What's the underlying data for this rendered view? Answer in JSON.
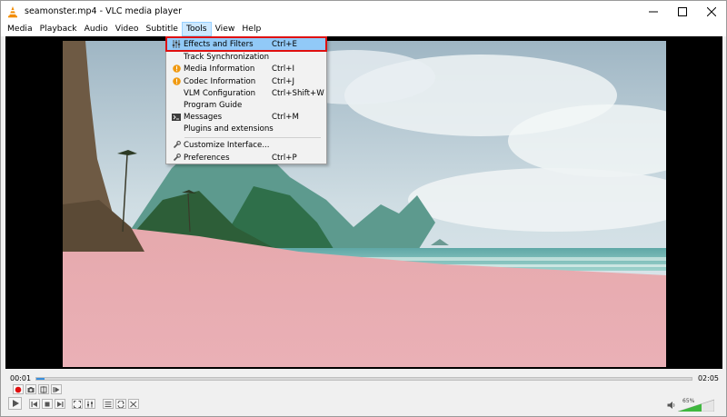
{
  "window": {
    "title": "seamonster.mp4 - VLC media player",
    "icon": "vlc-cone-icon"
  },
  "menubar": {
    "items": [
      "Media",
      "Playback",
      "Audio",
      "Video",
      "Subtitle",
      "Tools",
      "View",
      "Help"
    ],
    "active": "Tools"
  },
  "tools_menu": {
    "items": [
      {
        "label": "Effects and Filters",
        "shortcut": "Ctrl+E",
        "icon": "equalizer-icon",
        "highlighted": true
      },
      {
        "label": "Track Synchronization",
        "shortcut": "",
        "icon": ""
      },
      {
        "label": "Media Information",
        "shortcut": "Ctrl+I",
        "icon": "info-icon"
      },
      {
        "label": "Codec Information",
        "shortcut": "Ctrl+J",
        "icon": "info-icon"
      },
      {
        "label": "VLM Configuration",
        "shortcut": "Ctrl+Shift+W",
        "icon": ""
      },
      {
        "label": "Program Guide",
        "shortcut": "",
        "icon": ""
      },
      {
        "label": "Messages",
        "shortcut": "Ctrl+M",
        "icon": "terminal-icon"
      },
      {
        "label": "Plugins and extensions",
        "shortcut": "",
        "icon": ""
      },
      {
        "label": "Customize Interface...",
        "shortcut": "",
        "icon": "wrench-icon"
      },
      {
        "label": "Preferences",
        "shortcut": "Ctrl+P",
        "icon": "wrench-icon"
      }
    ]
  },
  "player": {
    "elapsed": "00:01",
    "duration": "02:05",
    "progress": 0.012,
    "volume_label": "65%",
    "volume": 0.65
  },
  "colors": {
    "menu_highlight": "#91c9f7",
    "annotation_box": "#e01010",
    "seek_fill": "#3a8fdc",
    "volume_fill": "#3fb83f",
    "record_button": "#e01010"
  }
}
